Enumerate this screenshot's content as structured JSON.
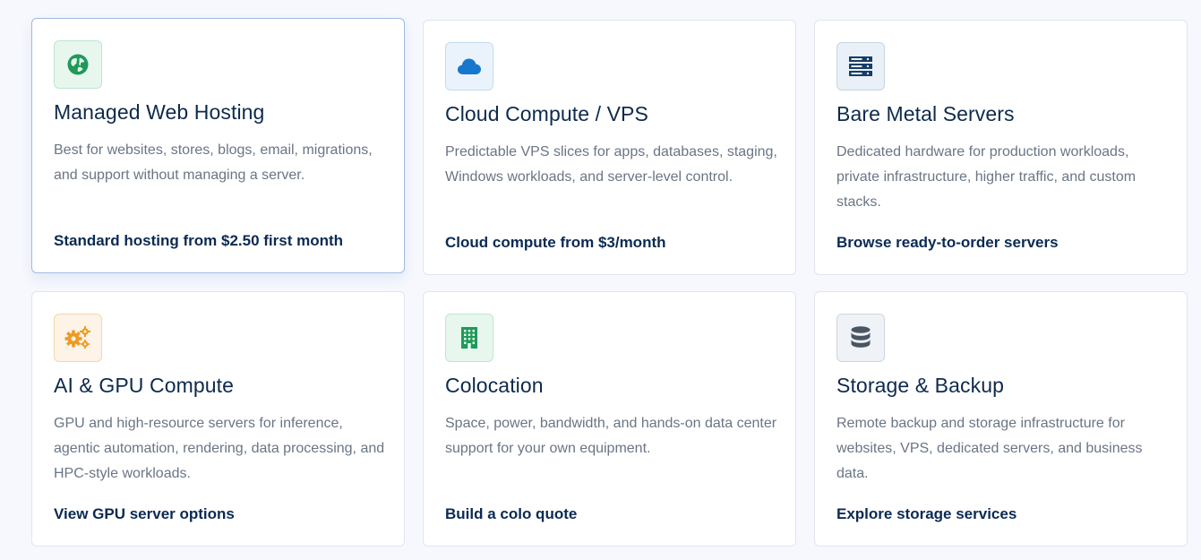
{
  "cards": [
    {
      "icon": "globe-icon",
      "title": "Managed Web Hosting",
      "description": "Best for websites, stores, blogs, email, migrations, and support without managing a server.",
      "link": "Standard hosting from $2.50 first month",
      "accent": "#1f9a58",
      "icon_bg": "#e7f7ee",
      "icon_border": "#bfe6cf"
    },
    {
      "icon": "cloud-icon",
      "title": "Cloud Compute / VPS",
      "description": "Predictable VPS slices for apps, databases, staging, Windows workloads, and server-level control.",
      "link": "Cloud compute from $3/month",
      "accent": "#1677cc",
      "icon_bg": "#eaf3fc",
      "icon_border": "#c2dbf2"
    },
    {
      "icon": "server-rack-icon",
      "title": "Bare Metal Servers",
      "description": "Dedicated hardware for production workloads, private infrastructure, higher traffic, and custom stacks.",
      "link": "Browse ready-to-order servers",
      "accent": "#153d66",
      "icon_bg": "#eaf0f7",
      "icon_border": "#c9d4e2"
    },
    {
      "icon": "gears-icon",
      "title": "AI & GPU Compute",
      "description": "GPU and high-resource servers for inference, agentic automation, rendering, data processing, and HPC-style workloads.",
      "link": "View GPU server options",
      "accent": "#ee9a22",
      "icon_bg": "#fdf3e6",
      "icon_border": "#f6d6ad"
    },
    {
      "icon": "building-icon",
      "title": "Colocation",
      "description": "Space, power, bandwidth, and hands-on data center support for your own equipment.",
      "link": "Build a colo quote",
      "accent": "#1f9a58",
      "icon_bg": "#e7f7ee",
      "icon_border": "#bfe6cf"
    },
    {
      "icon": "database-icon",
      "title": "Storage & Backup",
      "description": "Remote backup and storage infrastructure for websites, VPS, dedicated servers, and business data.",
      "link": "Explore storage services",
      "accent": "#4a5563",
      "icon_bg": "#eff2f6",
      "icon_border": "#cfd6e0"
    }
  ]
}
